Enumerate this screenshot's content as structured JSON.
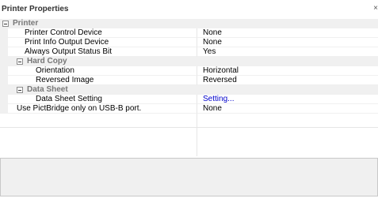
{
  "title": "Printer Properties",
  "close_glyph": "×",
  "categories": {
    "printer": "Printer",
    "hard_copy": "Hard Copy",
    "data_sheet": "Data Sheet"
  },
  "properties": {
    "printer_control_device": {
      "name": "Printer Control Device",
      "value": "None"
    },
    "print_info_output_device": {
      "name": "Print Info Output Device",
      "value": "None"
    },
    "always_output_status_bit": {
      "name": "Always Output Status Bit",
      "value": "Yes"
    },
    "orientation": {
      "name": "Orientation",
      "value": "Horizontal"
    },
    "reversed_image": {
      "name": "Reversed Image",
      "value": "Reversed"
    },
    "data_sheet_setting": {
      "name": "Data Sheet Setting",
      "value": "Setting..."
    },
    "use_pictbridge": {
      "name": "Use PictBridge only on USB-B port.",
      "value": "None"
    }
  },
  "description": "",
  "colors": {
    "category_background": "#f0f0f0",
    "category_text": "#777777",
    "link_text": "#0000cc",
    "description_background": "#f0f0f0"
  }
}
